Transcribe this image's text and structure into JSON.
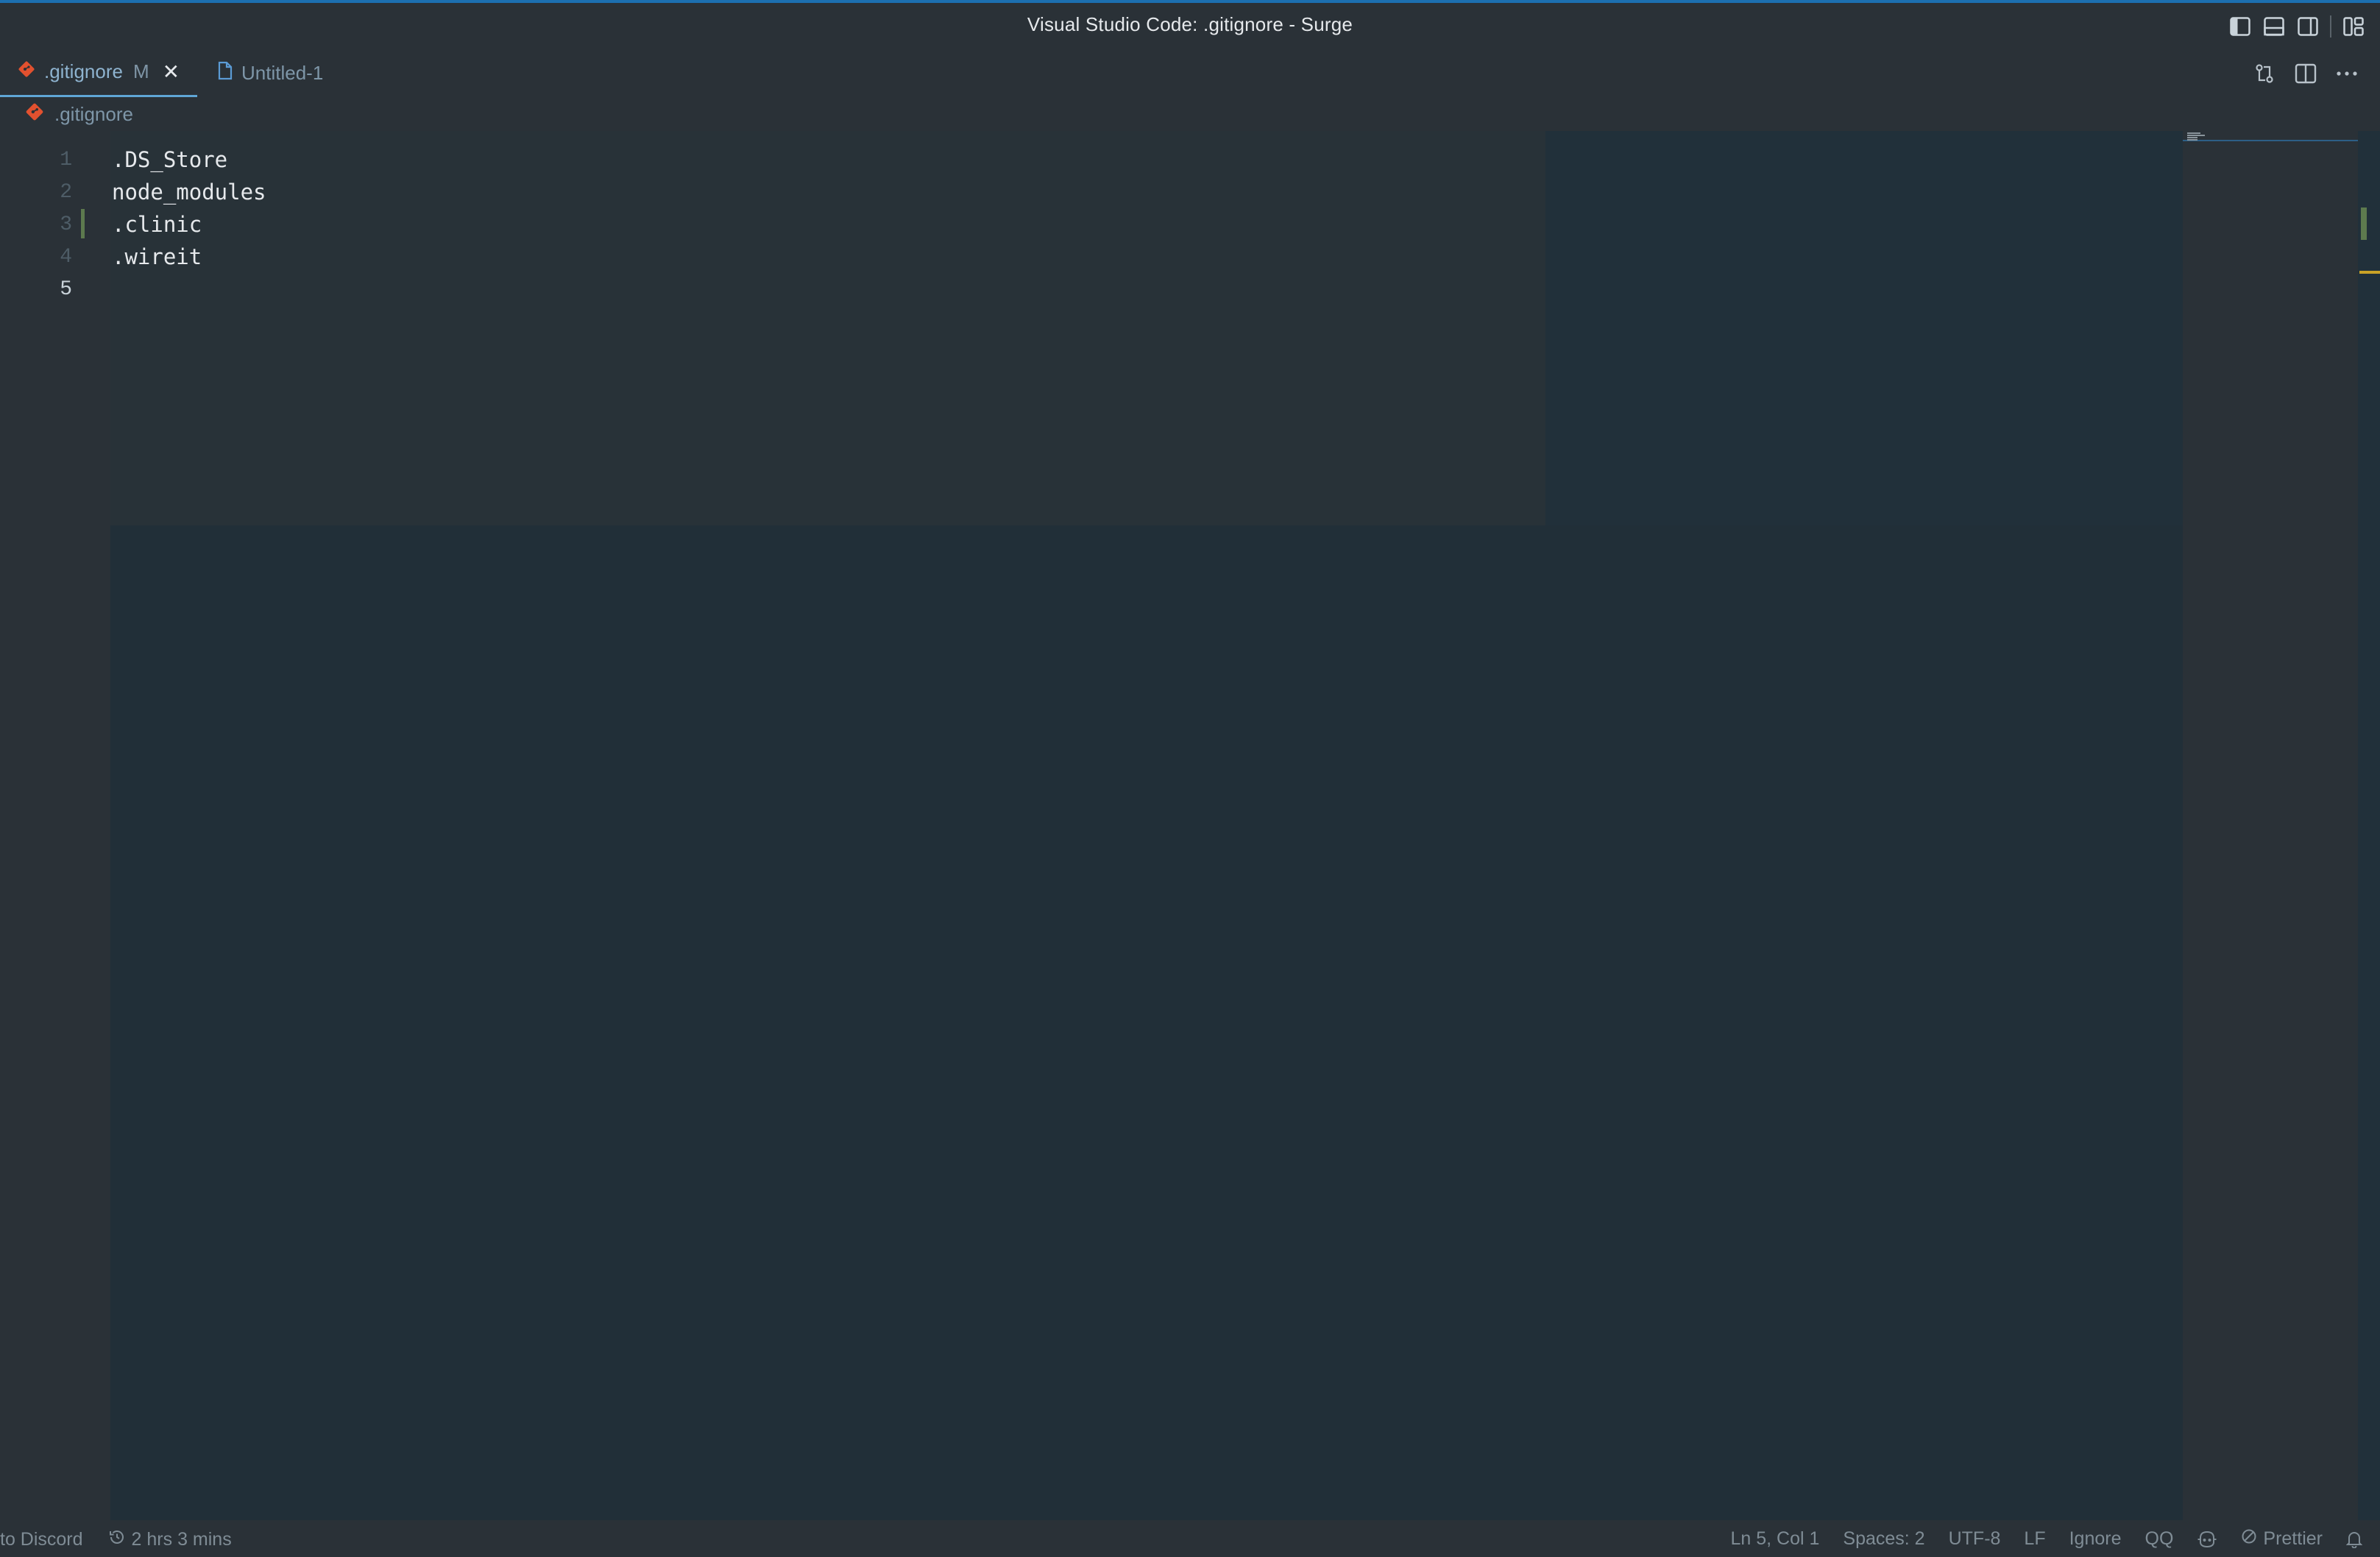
{
  "window": {
    "title": "Visual Studio Code: .gitignore - Surge"
  },
  "titlebar_icons": [
    "toggle-primary-sidebar-icon",
    "toggle-panel-icon",
    "toggle-secondary-sidebar-icon",
    "customize-layout-icon"
  ],
  "tabs": [
    {
      "label": ".gitignore",
      "modified_badge": "M",
      "close": "✕",
      "active": true,
      "icon": "git-icon"
    },
    {
      "label": "Untitled-1",
      "active": false,
      "icon": "file-icon"
    }
  ],
  "tab_actions": [
    "open-changes-icon",
    "split-editor-icon",
    "more-actions-icon"
  ],
  "breadcrumb": {
    "label": ".gitignore",
    "icon": "git-icon"
  },
  "editor": {
    "lines": [
      {
        "number": "1",
        "text": ".DS_Store"
      },
      {
        "number": "2",
        "text": "node_modules"
      },
      {
        "number": "3",
        "text": ".clinic"
      },
      {
        "number": "4",
        "text": ".wireit"
      },
      {
        "number": "5",
        "text": ""
      }
    ],
    "current_line": 5
  },
  "statusbar": {
    "discord": "to Discord",
    "time_tracked": "2 hrs 3 mins",
    "cursor_position": "Ln 5, Col 1",
    "indentation": "Spaces: 2",
    "encoding": "UTF-8",
    "line_ending": "LF",
    "language": "Ignore",
    "qq": "QQ",
    "prettier": "Prettier"
  },
  "colors": {
    "accent": "#1c6fb0",
    "git_icon": "#e2512f",
    "git_added": "#5d7a4e",
    "warning_mark": "#c9a227"
  }
}
